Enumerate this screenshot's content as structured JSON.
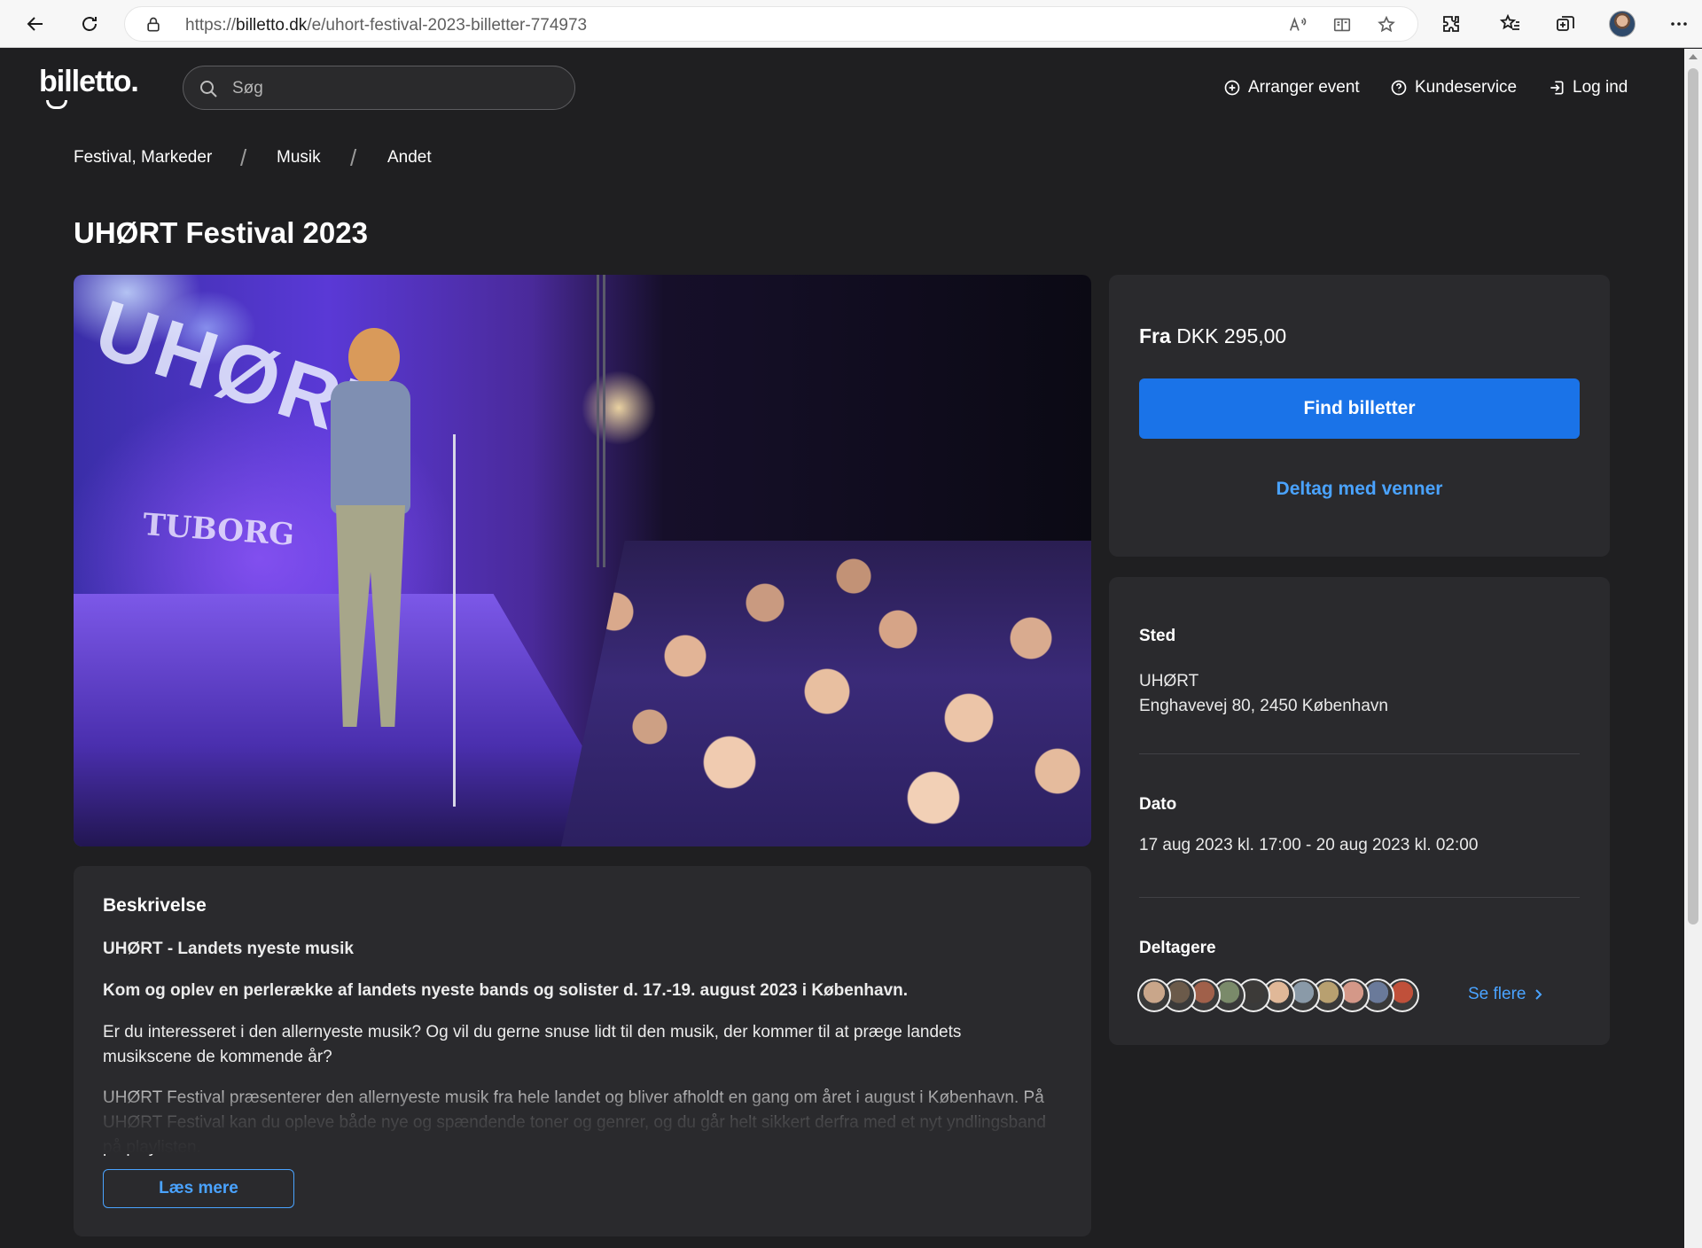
{
  "browser": {
    "url_prefix": "https://",
    "url_host": "billetto.dk",
    "url_path": "/e/uhort-festival-2023-billetter-774973"
  },
  "header": {
    "logo": "billetto.",
    "search_placeholder": "Søg",
    "nav": [
      {
        "label": "Arranger event",
        "icon": "plus-circle-icon"
      },
      {
        "label": "Kundeservice",
        "icon": "help-circle-icon"
      },
      {
        "label": "Log ind",
        "icon": "login-icon"
      }
    ]
  },
  "breadcrumb": [
    "Festival, Markeder",
    "Musik",
    "Andet"
  ],
  "breadcrumb_sep": "/",
  "event": {
    "title": "UHØRT Festival 2023",
    "image_text": {
      "banner": "UHØRT",
      "sponsor": "TUBORG"
    }
  },
  "tickets": {
    "price_prefix": "Fra",
    "price": "DKK 295,00",
    "find_button": "Find billetter",
    "friends_link": "Deltag med venner"
  },
  "info": {
    "venue_label": "Sted",
    "venue_name": "UHØRT",
    "venue_address": "Enghavevej 80, 2450 København",
    "date_label": "Dato",
    "date_value": "17 aug 2023 kl. 17:00 - 20 aug 2023 kl. 02:00",
    "attendees_label": "Deltagere",
    "see_more": "Se flere",
    "attendee_colors": [
      "#c9a68a",
      "#6b5a4a",
      "#a0604a",
      "#7a8a6a",
      "#3c3a38",
      "#e0b898",
      "#8a9aa8",
      "#b8a070",
      "#d49888",
      "#6a7a9a",
      "#c0503a"
    ]
  },
  "description": {
    "heading": "Beskrivelse",
    "subtitle": "UHØRT - Landets nyeste musik",
    "lead": "Kom og oplev en perlerække af landets nyeste bands og solister d. 17.-19. august 2023 i København.",
    "p1": "Er du interesseret i den allernyeste musik? Og vil du gerne snuse lidt til den musik, der kommer til at præge landets musikscene de kommende år?",
    "p2": "UHØRT Festival præsenterer den allernyeste musik fra hele landet og bliver afholdt en gang om året i august i København. På UHØRT Festival kan du opleve både nye og spændende toner og genrer, og du går helt sikkert derfra med et nyt yndlingsband på playlisten.",
    "read_more": "Læs mere"
  }
}
